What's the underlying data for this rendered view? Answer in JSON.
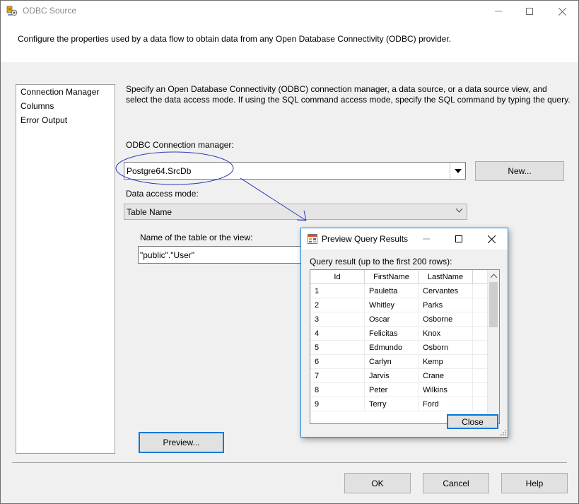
{
  "window": {
    "title": "ODBC Source",
    "description": "Configure the properties used by a data flow to obtain data from any Open Database Connectivity (ODBC) provider."
  },
  "nav": {
    "items": [
      "Connection Manager",
      "Columns",
      "Error Output"
    ]
  },
  "panel": {
    "description": "Specify an Open Database Connectivity (ODBC) connection manager, a data source, or a data source view, and select the data access mode. If using the SQL command access mode, specify the SQL command by typing the query.",
    "connection_label": "ODBC Connection manager:",
    "connection_value": "Postgre64.SrcDb",
    "new_button": "New...",
    "access_mode_label": "Data access mode:",
    "access_mode_value": "Table Name",
    "table_label": "Name of the table or the view:",
    "table_value": "\"public\".\"User\"",
    "preview_button": "Preview..."
  },
  "footer": {
    "ok": "OK",
    "cancel": "Cancel",
    "help": "Help"
  },
  "preview_dialog": {
    "title": "Preview Query Results",
    "caption": "Query result (up to the first 200 rows):",
    "columns": [
      "Id",
      "FirstName",
      "LastName"
    ],
    "rows": [
      [
        "1",
        "Pauletta",
        "Cervantes"
      ],
      [
        "2",
        "Whitley",
        "Parks"
      ],
      [
        "3",
        "Oscar",
        "Osborne"
      ],
      [
        "4",
        "Felicitas",
        "Knox"
      ],
      [
        "5",
        "Edmundo",
        "Osborn"
      ],
      [
        "6",
        "Carlyn",
        "Kemp"
      ],
      [
        "7",
        "Jarvis",
        "Crane"
      ],
      [
        "8",
        "Peter",
        "Wilkins"
      ],
      [
        "9",
        "Terry",
        "Ford"
      ]
    ],
    "close_button": "Close"
  },
  "colors": {
    "accent": "#0078d7",
    "annotation": "#2a3bb8"
  },
  "icons": {
    "app": "ssis-source-icon",
    "dialog": "grid-icon",
    "minimize": "minimize-icon",
    "maximize": "maximize-icon",
    "close": "close-icon",
    "dropdown": "chevron-down-icon"
  }
}
